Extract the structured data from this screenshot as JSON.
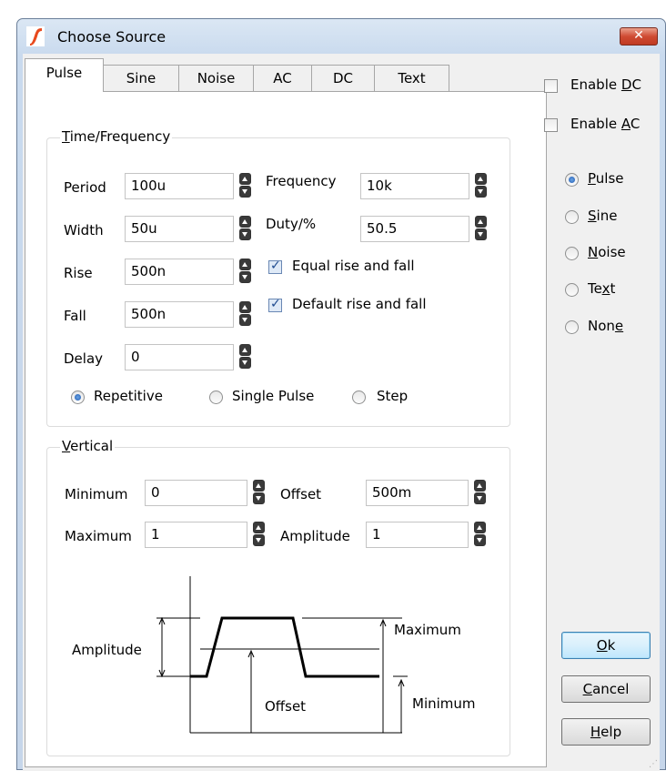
{
  "window": {
    "title": "Choose Source",
    "close_label": "✕"
  },
  "tabs": [
    {
      "label": "Pulse"
    },
    {
      "label": "Sine"
    },
    {
      "label": "Noise"
    },
    {
      "label": "AC"
    },
    {
      "label": "DC"
    },
    {
      "label": "Text"
    }
  ],
  "time_freq": {
    "title_mnemonic": "T",
    "title_rest": "ime/Frequency",
    "period_label": "Period",
    "period_value": "100u",
    "width_label": "Width",
    "width_value": "50u",
    "rise_label": "Rise",
    "rise_value": "500n",
    "fall_label": "Fall",
    "fall_value": "500n",
    "delay_label": "Delay",
    "delay_value": "0",
    "frequency_label": "Frequency",
    "frequency_value": "10k",
    "duty_label": "Duty/%",
    "duty_value": "50.5",
    "equal_rise_fall_label": "Equal rise and fall",
    "equal_rise_fall_checked": true,
    "default_rise_fall_label": "Default rise and fall",
    "default_rise_fall_checked": true,
    "mode_repetitive": "Repetitive",
    "mode_single_pulse": "Single Pulse",
    "mode_step": "Step",
    "mode_selected": "Repetitive"
  },
  "vertical": {
    "title_mnemonic": "V",
    "title_rest": "ertical",
    "minimum_label": "Minimum",
    "minimum_value": "0",
    "maximum_label": "Maximum",
    "maximum_value": "1",
    "offset_label": "Offset",
    "offset_value": "500m",
    "amplitude_label": "Amplitude",
    "amplitude_value": "1"
  },
  "diagram": {
    "amplitude": "Amplitude",
    "maximum": "Maximum",
    "offset": "Offset",
    "minimum": "Minimum"
  },
  "side": {
    "enable_dc_pre": "Enable ",
    "enable_dc_key": "D",
    "enable_dc_post": "C",
    "enable_dc_checked": false,
    "enable_ac_pre": "Enable ",
    "enable_ac_key": "A",
    "enable_ac_post": "C",
    "enable_ac_checked": false,
    "radios": [
      {
        "key": "P",
        "rest": "ulse",
        "selected": true
      },
      {
        "key": "S",
        "rest": "ine",
        "selected": false
      },
      {
        "key": "N",
        "rest": "oise",
        "selected": false
      },
      {
        "pre": "Te",
        "key": "x",
        "rest": "t",
        "selected": false
      },
      {
        "pre": "Non",
        "key": "e",
        "rest": "",
        "selected": false
      }
    ]
  },
  "buttons": {
    "ok_key": "O",
    "ok_rest": "k",
    "cancel_key": "C",
    "cancel_rest": "ancel",
    "help_key": "H",
    "help_rest": "elp"
  },
  "colors": {
    "accent_icon": "#e8491d",
    "close_red": "#c8432b",
    "selection_blue": "#1f5ab2"
  }
}
